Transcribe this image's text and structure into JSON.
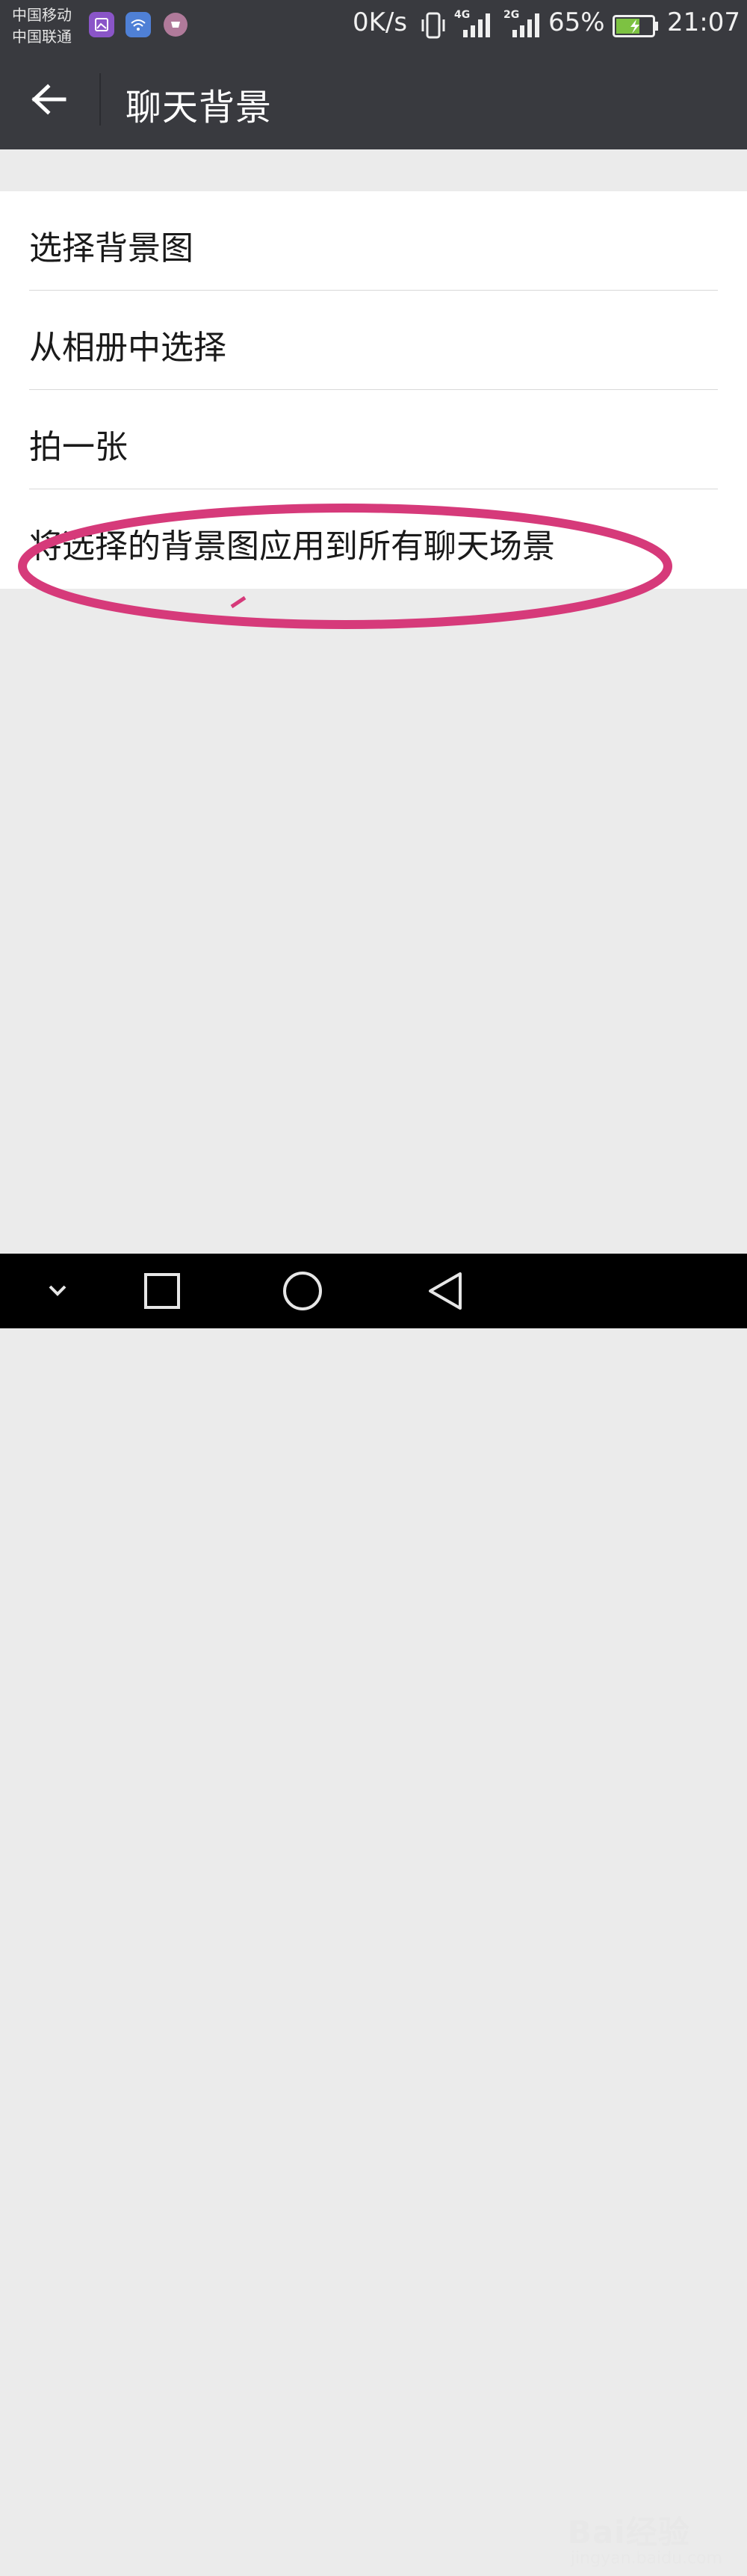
{
  "status_bar": {
    "carrier_1": "中国移动",
    "carrier_2": "中国联通",
    "net_speed": "0K/s",
    "network_1": "4G",
    "network_2": "2G",
    "battery": "65%",
    "battery_level": 0.65,
    "time": "21:07",
    "icons": [
      "gallery-icon",
      "wifi-icon",
      "shop-icon",
      "vibrate-icon",
      "signal-icon",
      "battery-icon"
    ]
  },
  "header": {
    "title": "聊天背景",
    "back_icon": "arrow-left-icon"
  },
  "menu": {
    "items": [
      {
        "label": "选择背景图"
      },
      {
        "label": "从相册中选择"
      },
      {
        "label": "拍一张"
      },
      {
        "label": "将选择的背景图应用到所有聊天场景"
      }
    ]
  },
  "nav_bar": {
    "buttons": [
      "chevron-down-icon",
      "recent-apps-icon",
      "home-icon",
      "back-icon"
    ]
  },
  "watermark": {
    "text": "Bai经验",
    "url": "jingyan.baidu.com"
  },
  "colors": {
    "header_bg": "#393a3f",
    "page_bg": "#ebebeb",
    "annotation": "#d63a7a"
  }
}
